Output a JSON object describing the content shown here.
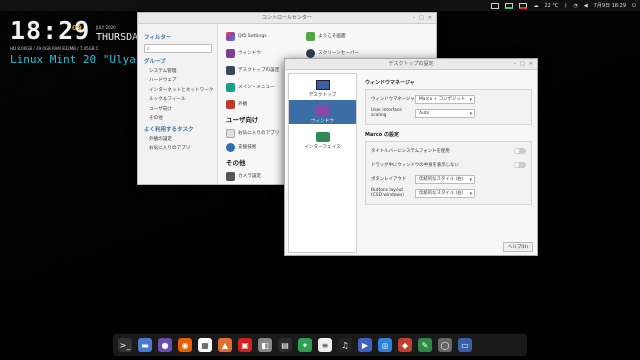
{
  "topbar": {
    "temperature": "22 °C",
    "datetime": "7月9日 18:29",
    "colors": {
      "indicator_green": "#3cd070",
      "indicator_red": "#e03030"
    }
  },
  "conky": {
    "time": "18:29",
    "day_number": "09",
    "date_text": "JULY 2020",
    "weekday": "THURSDAY",
    "stats_line": "HD 8.00GB / 29.0GB   RAM 832MB / 7.45GB   C",
    "os_title": "Linux Mint 20 \"Ulyana\" Ma",
    "colors": {
      "accent": "#e2a400",
      "os_title": "#29c4e0"
    }
  },
  "control_center": {
    "title": "コントロールセンター",
    "filter_heading": "フィルター",
    "search_placeholder": "",
    "group_heading": "グループ",
    "groups": [
      "システム管理",
      "ハードウェア",
      "インターネットとネットワーク",
      "ルック＆フィール",
      "ユーザ向け",
      "その他"
    ],
    "tasks_heading": "よく利用するタスク",
    "tasks": [
      "外観の設定",
      "お気に入りのアプリ"
    ],
    "items_top": [
      {
        "label": "Qt5 Settings",
        "icon": "qt-settings-icon",
        "color": "#8e44ad"
      },
      {
        "label": "ようこそ画面",
        "icon": "welcome-icon",
        "color": "#52a447"
      },
      {
        "label": "ウィンドウ",
        "icon": "window-icon",
        "color": "#7d3c98"
      },
      {
        "label": "スクリーンセーバー",
        "icon": "screensaver-icon",
        "color": "#2c3e50"
      },
      {
        "label": "デスクトップの設定",
        "icon": "desktop-settings-icon",
        "color": "#34495e"
      },
      {
        "label": "",
        "icon": "",
        "color": ""
      },
      {
        "label": "メイン・メニュー",
        "icon": "main-menu-icon",
        "color": "#16a085"
      },
      {
        "label": "",
        "icon": "",
        "color": ""
      },
      {
        "label": "外観",
        "icon": "appearance-icon",
        "color": "#c0392b"
      },
      {
        "label": "",
        "icon": "",
        "color": ""
      }
    ],
    "section_personal": "ユーザ向け",
    "items_personal": [
      {
        "label": "お気に入りのアプリ",
        "icon": "favorite-apps-icon",
        "color": "#e0e0e0"
      },
      {
        "label": "支援技術",
        "icon": "accessibility-icon",
        "color": "#2e6fb7"
      }
    ],
    "section_other": "その他",
    "items_other": [
      {
        "label": "カメラ設定",
        "icon": "camera-icon",
        "color": "#555"
      }
    ]
  },
  "desktop_settings": {
    "title": "デスクトップの設定",
    "categories": [
      {
        "label": "デスクトップ",
        "icon": "desktop-icon",
        "active": false
      },
      {
        "label": "ウィンドウ",
        "icon": "window-icon",
        "active": true
      },
      {
        "label": "インターフェイス",
        "icon": "interface-icon",
        "active": false
      }
    ],
    "wm_heading": "ウィンドウマネージャ",
    "wm_label": "ウィンドウマネージャ",
    "wm_value": "Marco + コンポジット",
    "scaling_label": "User interface scaling",
    "scaling_value": "Auto",
    "marco_heading": "Marco の設定",
    "opt_title_font": "タイトルバーにシステムフォントを使用",
    "opt_drag_contents": "ドラッグ中にウィンドウの中身を表示しない",
    "button_layout_label": "ボタンレイアウト",
    "button_layout_value": "伝統的なスタイル (右)",
    "csd_label": "Buttons layout (CSD windows)",
    "csd_value": "伝統的なスタイル (右)",
    "help_label": "ヘルプ(H)",
    "colors": {
      "active_bg": "#3a6ea5"
    }
  },
  "dock": {
    "items": [
      {
        "icon": "terminal-icon",
        "color": "#333",
        "glyph": ">_"
      },
      {
        "icon": "files-icon",
        "color": "#4a7bd0",
        "glyph": "▬"
      },
      {
        "icon": "pidgin-icon",
        "color": "#6a4fb0",
        "glyph": "●"
      },
      {
        "icon": "firefox-icon",
        "color": "#e66000",
        "glyph": "◉"
      },
      {
        "icon": "sheets-icon",
        "color": "#ffffff",
        "glyph": "▦"
      },
      {
        "icon": "image-viewer-icon",
        "color": "#e07030",
        "glyph": "▲"
      },
      {
        "icon": "store-icon",
        "color": "#d02020",
        "glyph": "▣"
      },
      {
        "icon": "screenshot-icon",
        "color": "#888",
        "glyph": "◧"
      },
      {
        "icon": "calculator-icon",
        "color": "#2a2a2a",
        "glyph": "▤"
      },
      {
        "icon": "settings-icon",
        "color": "#2e9e50",
        "glyph": "✦"
      },
      {
        "icon": "text-editor-icon",
        "color": "#f0f0f0",
        "glyph": "≡"
      },
      {
        "icon": "music-icon",
        "color": "#222",
        "glyph": "♫"
      },
      {
        "icon": "video-icon",
        "color": "#4060c0",
        "glyph": "▶"
      },
      {
        "icon": "camera-icon",
        "color": "#3080e0",
        "glyph": "◎"
      },
      {
        "icon": "chat-icon",
        "color": "#c04030",
        "glyph": "◆"
      },
      {
        "icon": "editor-icon",
        "color": "#2f8a4a",
        "glyph": "✎"
      },
      {
        "icon": "disks-icon",
        "color": "#666",
        "glyph": "◯"
      },
      {
        "icon": "workspace-icon",
        "color": "#3a5fa8",
        "glyph": "▭"
      }
    ]
  }
}
